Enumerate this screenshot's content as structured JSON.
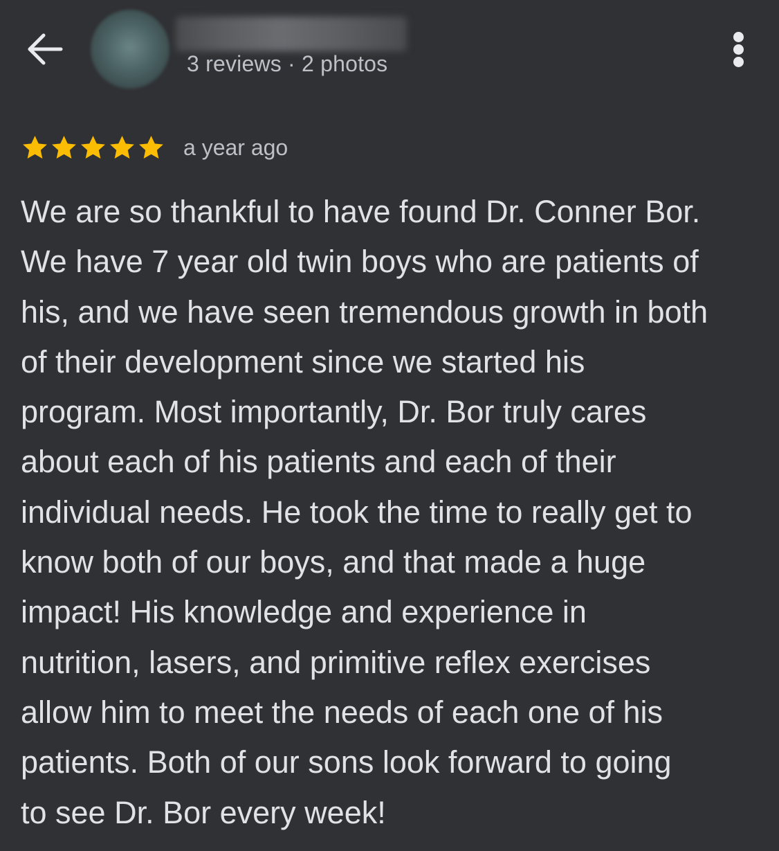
{
  "header": {
    "back_icon": "arrow-left-icon",
    "reviewer_name": "",
    "reviewer_meta": "3 reviews · 2 photos",
    "more_icon": "more-vertical-icon"
  },
  "review": {
    "rating": 5,
    "rating_max": 5,
    "star_color": "#fbbc04",
    "time_ago": "a year ago",
    "lines": [
      "We are so thankful to have found Dr. Conner Bor.",
      "We have 7 year old twin boys who are patients of",
      "his, and we have seen tremendous growth in both",
      "of their development since we started his",
      "program. Most importantly, Dr. Bor truly cares",
      "about each of his patients and each of their",
      "individual needs. He took the time to really get to",
      "know both of our boys, and that made a huge",
      "impact! His knowledge and experience in",
      "nutrition, lasers, and primitive reflex exercises",
      "allow him to meet the needs of each one of his",
      "patients. Both of our sons look forward to going",
      "to see Dr. Bor every week!"
    ]
  },
  "colors": {
    "background": "#303134",
    "primary_text": "#e0e2e6",
    "secondary_text": "#bdc1c6"
  }
}
